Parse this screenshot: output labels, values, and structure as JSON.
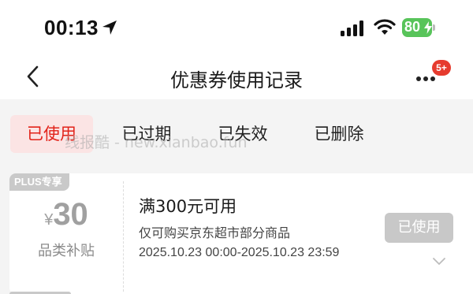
{
  "status_bar": {
    "time": "00:13",
    "battery": "80",
    "battery_color": "#58c45a"
  },
  "nav": {
    "title": "优惠券使用记录",
    "badge": "5+",
    "back_icon": "chevron-left-icon",
    "more_icon": "more-dots-icon"
  },
  "tabs": [
    {
      "label": "已使用",
      "active": true
    },
    {
      "label": "已过期",
      "active": false
    },
    {
      "label": "已失效",
      "active": false
    },
    {
      "label": "已删除",
      "active": false
    }
  ],
  "watermark": "线报酷 - new.xianbao.fun",
  "coupon": {
    "tag": "PLUS专享",
    "currency": "¥",
    "amount": "30",
    "type_label": "品类补贴",
    "condition": "满300元可用",
    "scope": "仅可购买京东超市部分商品",
    "validity": "2025.10.23 00:00-2025.10.23 23:59",
    "status_button": "已使用"
  },
  "colors": {
    "accent": "#e2231a",
    "active_tab_bg": "#fbe4e4",
    "badge": "#e63b2e",
    "disabled_button": "#c8c8c8"
  }
}
